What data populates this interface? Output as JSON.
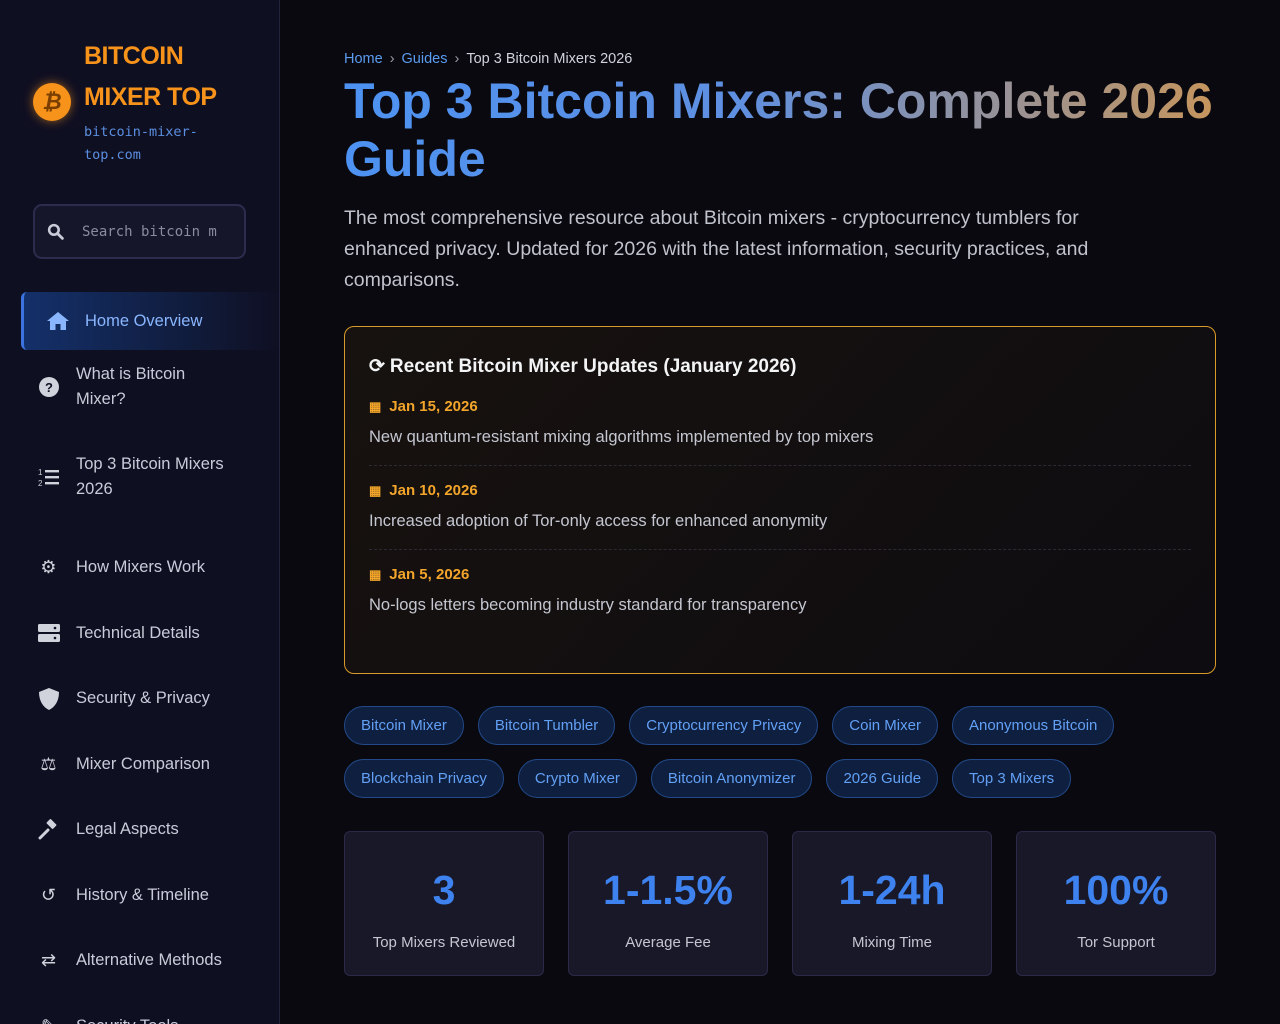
{
  "sidebar": {
    "brand_line1": "BITCOIN",
    "brand_line2": "MIXER TOP",
    "domain_line1": "bitcoin-mixer-",
    "domain_line2": "top.com",
    "search_placeholder": "Search bitcoin m",
    "items": [
      {
        "label": "Home Overview",
        "icon": "home-icon"
      },
      {
        "label": "What is Bitcoin Mixer?",
        "icon": "question-circle-icon"
      },
      {
        "label": "Top 3 Bitcoin Mixers 2026",
        "icon": "ordered-list-icon"
      },
      {
        "label": "How Mixers Work",
        "icon": "gears-icon"
      },
      {
        "label": "Technical Details",
        "icon": "server-icon"
      },
      {
        "label": "Security & Privacy",
        "icon": "shield-icon"
      },
      {
        "label": "Mixer Comparison",
        "icon": "scale-icon"
      },
      {
        "label": "Legal Aspects",
        "icon": "gavel-icon"
      },
      {
        "label": "History & Timeline",
        "icon": "history-icon"
      },
      {
        "label": "Alternative Methods",
        "icon": "exchange-icon"
      },
      {
        "label": "Security Tools",
        "icon": "tools-icon"
      }
    ]
  },
  "breadcrumb": {
    "home": "Home",
    "guides": "Guides",
    "current": "Top 3 Bitcoin Mixers 2026",
    "sep": "›"
  },
  "title": "Top 3 Bitcoin Mixers: Complete 2026 Guide",
  "lead": "The most comprehensive resource about Bitcoin mixers - cryptocurrency tumblers for enhanced privacy. Updated for 2026 with the latest information, security practices, and comparisons.",
  "updates": {
    "heading": "Recent Bitcoin Mixer Updates (January 2026)",
    "items": [
      {
        "date": "Jan 15, 2026",
        "text": "New quantum-resistant mixing algorithms implemented by top mixers"
      },
      {
        "date": "Jan 10, 2026",
        "text": "Increased adoption of Tor-only access for enhanced anonymity"
      },
      {
        "date": "Jan 5, 2026",
        "text": "No-logs letters becoming industry standard for transparency"
      }
    ]
  },
  "tags": [
    "Bitcoin Mixer",
    "Bitcoin Tumbler",
    "Cryptocurrency Privacy",
    "Coin Mixer",
    "Anonymous Bitcoin",
    "Blockchain Privacy",
    "Crypto Mixer",
    "Bitcoin Anonymizer",
    "2026 Guide",
    "Top 3 Mixers"
  ],
  "stats": [
    {
      "value": "3",
      "label": "Top Mixers Reviewed"
    },
    {
      "value": "1-1.5%",
      "label": "Average Fee"
    },
    {
      "value": "1-24h",
      "label": "Mixing Time"
    },
    {
      "value": "100%",
      "label": "Tor Support"
    }
  ],
  "colors": {
    "accent": "#3d82ee",
    "brand": "#f7931a",
    "highlight": "#f2a52a"
  }
}
